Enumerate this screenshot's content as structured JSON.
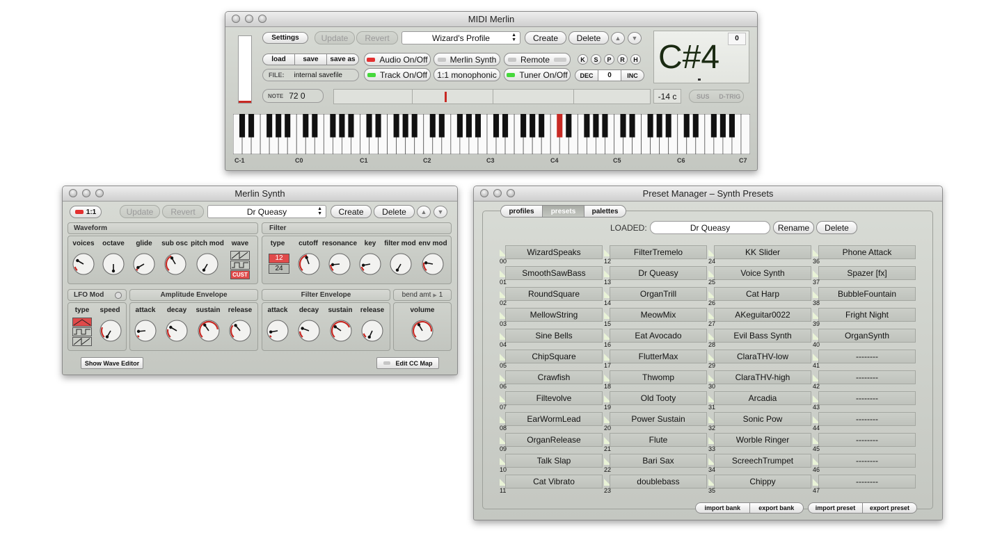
{
  "midi_merlin": {
    "title": "MIDI Merlin",
    "settings": "Settings",
    "update": "Update",
    "revert": "Revert",
    "profile": "Wizard's Profile",
    "create": "Create",
    "delete": "Delete",
    "load": "load",
    "save": "save",
    "save_as": "save as",
    "file_label": "FILE:",
    "file_value": "internal savefile",
    "audio": "Audio On/Off",
    "track": "Track On/Off",
    "merlin_synth": "Merlin Synth",
    "mono": "1:1 monophonic",
    "remote": "Remote",
    "tuner": "Tuner On/Off",
    "letters": [
      "K",
      "S",
      "P",
      "R",
      "H"
    ],
    "dec": "DEC",
    "dec_value": "0",
    "inc": "INC",
    "note_label": "NOTE",
    "note_value": "72 0",
    "cents": "-14 c",
    "sus": "SUS",
    "dtrig": "D-TRIG",
    "display_note": "C#4",
    "display_count": "0",
    "octave_labels": [
      "C-1",
      "C0",
      "C1",
      "C2",
      "C3",
      "C4",
      "C5",
      "C6",
      "C7"
    ],
    "pressed_key": "C#4"
  },
  "merlin_synth": {
    "title": "Merlin Synth",
    "ratio": "1:1",
    "update": "Update",
    "revert": "Revert",
    "preset": "Dr Queasy",
    "create": "Create",
    "delete": "Delete",
    "waveform_title": "Waveform",
    "waveform_knobs": [
      "voices",
      "octave",
      "glide",
      "sub osc",
      "pitch mod"
    ],
    "wave_label": "wave",
    "wave_cust": "CUST",
    "filter_title": "Filter",
    "filter_type": "type",
    "filter_12": "12",
    "filter_24": "24",
    "filter_knobs": [
      "cutoff",
      "resonance",
      "key",
      "filter mod",
      "env mod"
    ],
    "lfo_title": "LFO Mod",
    "lfo_type": "type",
    "lfo_speed": "speed",
    "amp_title": "Amplitude Envelope",
    "filter_env_title": "Filter Envelope",
    "env_knobs": [
      "attack",
      "decay",
      "sustain",
      "release"
    ],
    "bend_label": "bend amt",
    "bend_value": "1",
    "volume": "volume",
    "show_wave_editor": "Show Wave Editor",
    "edit_cc_map": "Edit CC Map"
  },
  "preset_manager": {
    "title": "Preset Manager – Synth Presets",
    "tabs": [
      "profiles",
      "presets",
      "palettes"
    ],
    "loaded_label": "LOADED:",
    "loaded_value": "Dr Queasy",
    "rename": "Rename",
    "delete": "Delete",
    "presets": [
      [
        "WizardSpeaks",
        "SmoothSawBass",
        "RoundSquare",
        "MellowString",
        "Sine Bells",
        "ChipSquare",
        "Crawfish",
        "Filtevolve",
        "EarWormLead",
        "OrganRelease",
        "Talk Slap",
        "Cat Vibrato"
      ],
      [
        "FilterTremelo",
        "Dr Queasy",
        "OrganTrill",
        "MeowMix",
        "Eat Avocado",
        "FlutterMax",
        "Thwomp",
        "Old Tooty",
        "Power Sustain",
        "Flute",
        "Bari Sax",
        "doublebass"
      ],
      [
        "KK Slider",
        "Voice Synth",
        "Cat Harp",
        "AKeguitar0022",
        "Evil Bass Synth",
        "ClaraTHV-low",
        "ClaraTHV-high",
        "Arcadia",
        "Sonic Pow",
        "Worble Ringer",
        "ScreechTrumpet",
        "Chippy"
      ],
      [
        "Phone Attack",
        "Spazer [fx]",
        "BubbleFountain",
        "Fright Night",
        "OrganSynth",
        "--------",
        "--------",
        "--------",
        "--------",
        "--------",
        "--------",
        "--------"
      ]
    ],
    "numbers": [
      [
        "00",
        "01",
        "02",
        "03",
        "04",
        "05",
        "06",
        "07",
        "08",
        "09",
        "10",
        "11"
      ],
      [
        "12",
        "13",
        "14",
        "15",
        "16",
        "17",
        "18",
        "19",
        "20",
        "21",
        "22",
        "23"
      ],
      [
        "24",
        "25",
        "26",
        "27",
        "28",
        "29",
        "30",
        "31",
        "32",
        "33",
        "34",
        "35"
      ],
      [
        "36",
        "37",
        "38",
        "39",
        "40",
        "41",
        "42",
        "43",
        "44",
        "45",
        "46",
        "47"
      ]
    ],
    "import_bank": "import bank",
    "export_bank": "export bank",
    "import_preset": "import preset",
    "export_preset": "export preset"
  },
  "colors": {
    "accent_red": "#c82a24",
    "led_green": "#46d83c",
    "display_text": "#1a2a12"
  }
}
